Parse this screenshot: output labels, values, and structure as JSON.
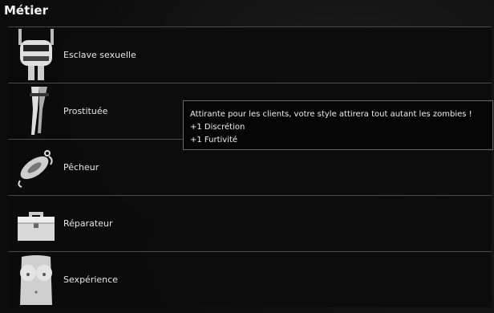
{
  "title": "Métier",
  "items": [
    {
      "label": "Esclave sexuelle",
      "icon": "chained-hands-icon"
    },
    {
      "label": "Prostituée",
      "icon": "stocking-legs-icon"
    },
    {
      "label": "Pêcheur",
      "icon": "fishing-lure-icon"
    },
    {
      "label": "Réparateur",
      "icon": "toolbox-icon"
    },
    {
      "label": "Sexpérience",
      "icon": "torso-icon"
    }
  ],
  "tooltip": {
    "line1": "Attirante pour les clients, votre style attirera tout autant les zombies !",
    "line2": "+1 Discrétion",
    "line3": "+1 Furtivité"
  }
}
